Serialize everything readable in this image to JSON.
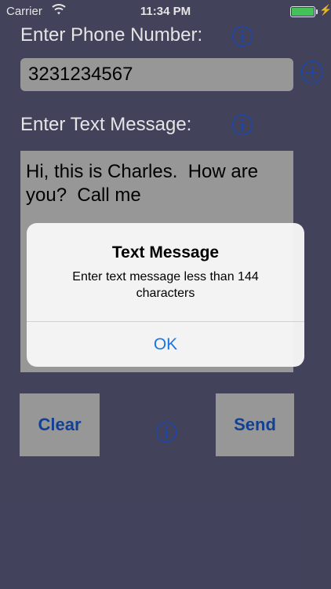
{
  "status_bar": {
    "carrier": "Carrier",
    "time": "11:34 PM",
    "wifi_icon": "wifi-icon",
    "battery_level": 1.0,
    "battery_color": "#4cd964"
  },
  "form": {
    "phone_label": "Enter Phone Number:",
    "phone_value": "3231234567",
    "message_label": "Enter Text Message:",
    "message_value": "Hi, this is Charles.  How are\nyou?  Call me",
    "info_icon": "info-icon",
    "add_contact_icon": "plus-circle-icon"
  },
  "buttons": {
    "clear_label": "Clear",
    "send_label": "Send"
  },
  "alert": {
    "title": "Text Message",
    "message": "Enter text message less than 144 characters",
    "ok_label": "OK"
  },
  "colors": {
    "background": "#4a4a66",
    "field_gray": "#a9a9a9",
    "button_text": "#1548a4",
    "icon_blue": "#1f4fbf",
    "ios_blue": "#1a76e3"
  }
}
